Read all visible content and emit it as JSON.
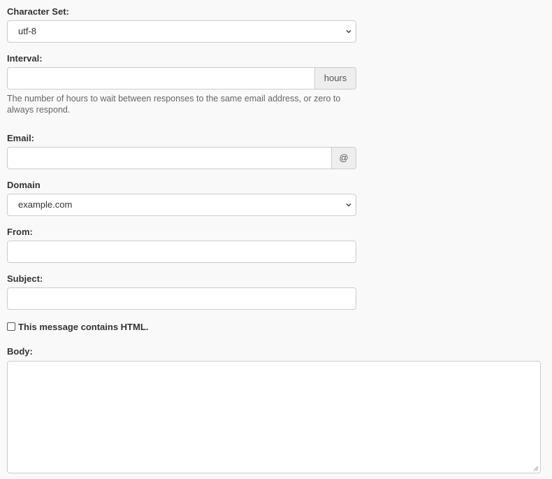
{
  "character_set": {
    "label": "Character Set:",
    "selected": "utf-8"
  },
  "interval": {
    "label": "Interval:",
    "value": "",
    "addon": "hours",
    "help": "The number of hours to wait between responses to the same email address, or zero to always respond."
  },
  "email": {
    "label": "Email:",
    "value": "",
    "addon": "@"
  },
  "domain": {
    "label": "Domain",
    "selected": "example.com"
  },
  "from": {
    "label": "From:",
    "value": ""
  },
  "subject": {
    "label": "Subject:",
    "value": ""
  },
  "html_checkbox": {
    "label": "This message contains HTML.",
    "checked": false
  },
  "body": {
    "label": "Body:",
    "value": ""
  }
}
